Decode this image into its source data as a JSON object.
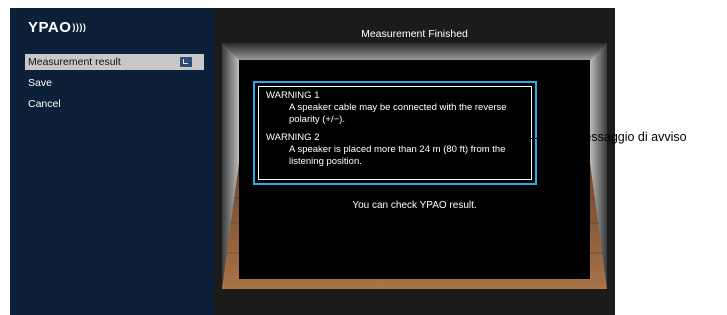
{
  "sidebar": {
    "logo": "YPAO",
    "logo_mark": "))))",
    "items": [
      {
        "label": "Measurement result",
        "selected": true
      },
      {
        "label": "Save",
        "selected": false
      },
      {
        "label": "Cancel",
        "selected": false
      }
    ]
  },
  "main": {
    "title": "Measurement Finished",
    "warnings": [
      {
        "title": "WARNING 1",
        "text_line1": "A speaker cable may be connected with the reverse",
        "text_line2": "polarity (+/−)."
      },
      {
        "title": "WARNING 2",
        "text_line1": "A speaker is placed more than 24 m (80 ft) from the",
        "text_line2": "listening position."
      }
    ],
    "footer_text": "You can check YPAO result."
  },
  "callout": {
    "label": "Messaggio di avviso"
  },
  "colors": {
    "sidebar_bg": "#0c2038",
    "warning_border": "#2ea8e6",
    "selected_bg": "#c8c8c8",
    "floor": "#8a5a35"
  },
  "icons": {
    "menu_enter": "return-arrow-icon"
  }
}
